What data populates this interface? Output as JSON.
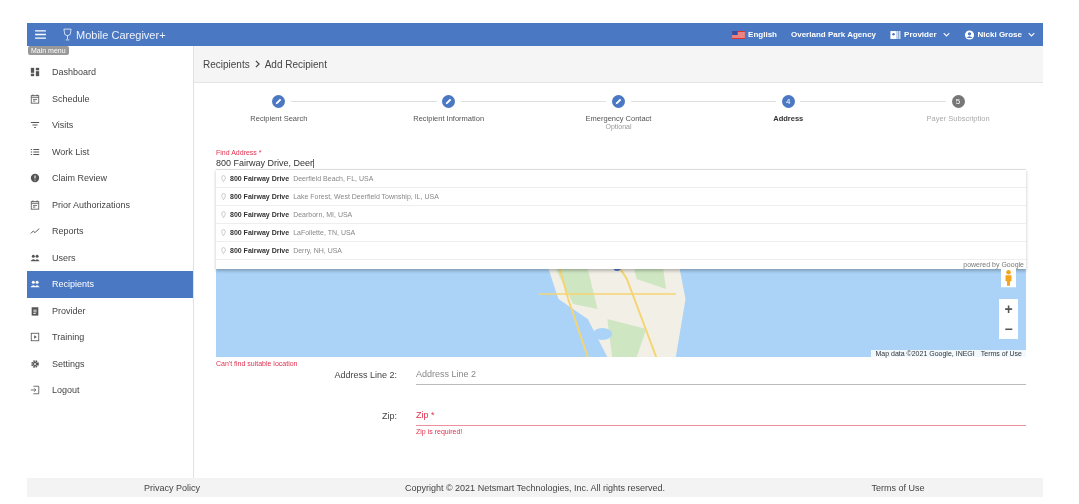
{
  "app_bar": {
    "title": "Mobile Caregiver+",
    "language": "English",
    "agency": "Overland Park Agency",
    "role": "Provider",
    "user": "Nicki Grose"
  },
  "tooltip": "Main menu",
  "sidebar": {
    "items": [
      {
        "label": "Dashboard",
        "selected": false
      },
      {
        "label": "Schedule",
        "selected": false
      },
      {
        "label": "Visits",
        "selected": false
      },
      {
        "label": "Work List",
        "selected": false
      },
      {
        "label": "Claim Review",
        "selected": false
      },
      {
        "label": "Prior Authorizations",
        "selected": false
      },
      {
        "label": "Reports",
        "selected": false
      },
      {
        "label": "Users",
        "selected": false
      },
      {
        "label": "Recipients",
        "selected": true
      },
      {
        "label": "Provider",
        "selected": false
      },
      {
        "label": "Training",
        "selected": false
      },
      {
        "label": "Settings",
        "selected": false
      },
      {
        "label": "Logout",
        "selected": false
      }
    ]
  },
  "breadcrumb": [
    "Recipients",
    "Add Recipient"
  ],
  "steps": [
    {
      "label": "Recipient Search",
      "completed": true,
      "selected": false
    },
    {
      "label": "Recipient Information",
      "completed": true,
      "selected": false
    },
    {
      "label": "Emergency Contact",
      "sublabel": "Optional",
      "completed": true,
      "selected": false
    },
    {
      "label": "Address",
      "number": "4",
      "completed": false,
      "selected": true
    },
    {
      "label": "Payer Subscription",
      "number": "5",
      "completed": false,
      "selected": false
    }
  ],
  "find_address": {
    "label": "Find Address *",
    "value": "800 Fairway Drive, Deer",
    "error": "Can't find suitable location",
    "suggestions": [
      {
        "main": "800 Fairway Drive",
        "secondary": "Deerfield Beach, FL, USA"
      },
      {
        "main": "800 Fairway Drive",
        "secondary": "Lake Forest, West Deerfield Township, IL, USA"
      },
      {
        "main": "800 Fairway Drive",
        "secondary": "Dearborn, MI, USA"
      },
      {
        "main": "800 Fairway Drive",
        "secondary": "LaFollette, TN, USA"
      },
      {
        "main": "800 Fairway Drive",
        "secondary": "Derry, NH, USA"
      }
    ],
    "powered_by": "powered by Google"
  },
  "map": {
    "zoom_in": "+",
    "zoom_out": "−",
    "attribution": "Map data ©2021 Google, INEGI",
    "terms": "Terms of Use"
  },
  "fields": [
    {
      "label": "Address Line 2:",
      "placeholder": "Address Line 2",
      "invalid": false
    },
    {
      "label": "Zip:",
      "placeholder": "Zip *",
      "invalid": true,
      "error": "Zip is required!"
    }
  ],
  "footer": {
    "privacy": "Privacy Policy",
    "copyright": "Copyright © 2021 Netsmart Technologies, Inc. All rights reserved.",
    "terms": "Terms of Use"
  }
}
